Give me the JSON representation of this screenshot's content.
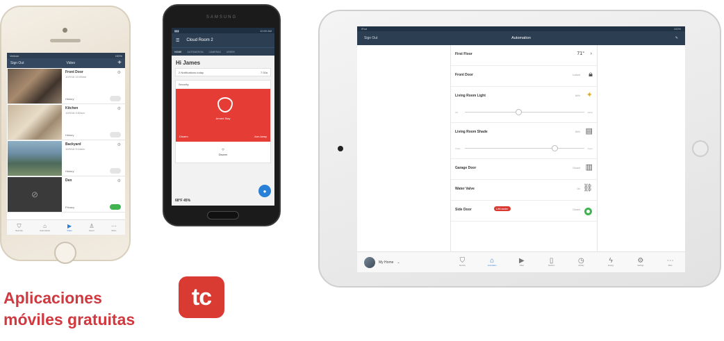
{
  "tagline": {
    "line1": "Aplicaciones",
    "line2": "móviles gratuitas"
  },
  "logo": {
    "text": "tc",
    "color": "#d93b33"
  },
  "iphone": {
    "status_left": "Verizon",
    "status_right": "100%",
    "nav_left": "Sign Out",
    "nav_title": "Video",
    "nav_add": "+",
    "cameras": [
      {
        "name": "Front Door",
        "date": "10/9/16 10:05am",
        "history": "History",
        "toggle": false
      },
      {
        "name": "Kitchen",
        "date": "10/9/16 9:52am",
        "history": "History",
        "toggle": false
      },
      {
        "name": "Backyard",
        "date": "10/9/16 9:14am",
        "history": "History",
        "toggle": false
      },
      {
        "name": "Den",
        "date": "",
        "history": "Privacy",
        "toggle": true
      }
    ],
    "tabs": [
      "Security",
      "Automation",
      "Video",
      "Users",
      "More"
    ]
  },
  "samsung": {
    "brand": "SAMSUNG",
    "status_right": "10:00 AM",
    "title": "Cloud Room 2",
    "tabs": [
      "HOME",
      "AUTOMATION",
      "CAMERAS",
      "USERS"
    ],
    "greeting": "Hi James",
    "notification": "2 Notifications today",
    "notification_right": "7:30a",
    "section": "Security",
    "armed": "Armed Stay",
    "arm_left": "Disarm",
    "arm_right": "Arm Away",
    "disarm_label": "Disarm",
    "bottom": "68°F  45%",
    "fab": "●"
  },
  "ipad": {
    "status_left": "iPad",
    "status_right": "100%",
    "nav_left": "Sign Out",
    "nav_title": "Automation",
    "rows": [
      {
        "name": "First Floor",
        "temp": "71°",
        "icon": "thermostat-icon"
      },
      {
        "name": "Front Door",
        "value": "Locked",
        "icon": "lock-icon"
      },
      {
        "name": "Living Room Light",
        "value": "60%",
        "icon": "bulb-icon",
        "slider": {
          "min": "Off",
          "max": "100%",
          "level": 0.45
        }
      },
      {
        "name": "Living Room Shade",
        "value": "80%",
        "icon": "shade-icon",
        "slider": {
          "min": "Close",
          "max": "Open",
          "level": 0.75
        }
      },
      {
        "name": "Garage Door",
        "value": "Closed",
        "icon": "garage-icon"
      },
      {
        "name": "Water Valve",
        "value": "On",
        "icon": "valve-icon"
      },
      {
        "name": "Side Door",
        "value": "Closed",
        "icon": "ring-icon",
        "badge": "Liftmaster"
      }
    ],
    "home_label": "My Home",
    "dock": [
      "Security",
      "Automation",
      "Video",
      "Devices",
      "Activity",
      "Energy",
      "Settings",
      "More"
    ]
  }
}
